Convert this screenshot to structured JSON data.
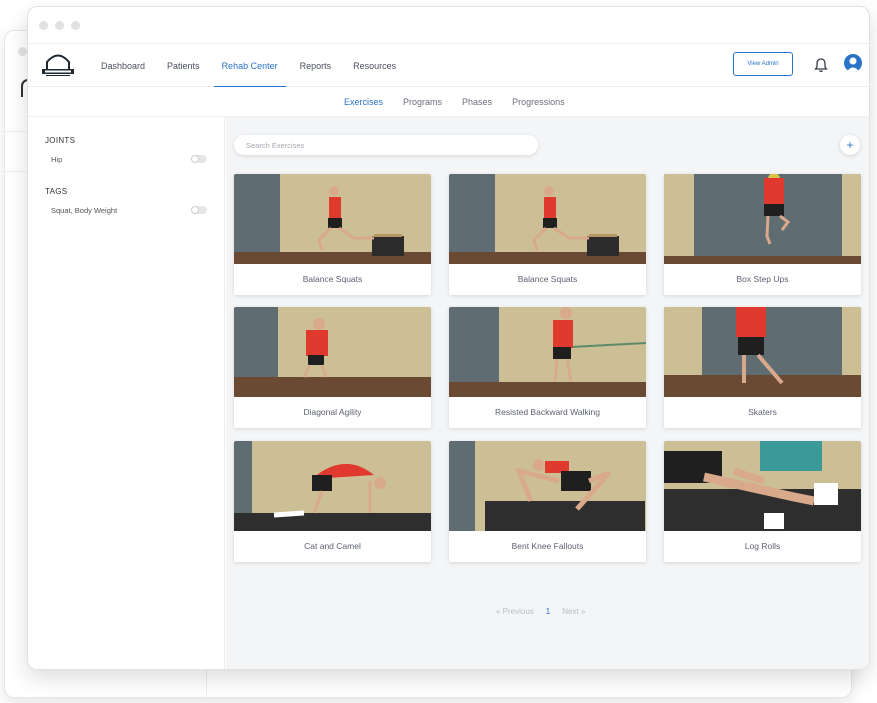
{
  "nav": {
    "links": [
      "Dashboard",
      "Patients",
      "Rehab Center",
      "Reports",
      "Resources"
    ],
    "active": "Rehab Center",
    "admin_button": "View Admin"
  },
  "subnav": {
    "tabs": [
      "Exercises",
      "Programs",
      "Phases",
      "Progressions"
    ],
    "active": "Exercises"
  },
  "filters": {
    "joints_heading": "JOINTS",
    "joints": [
      "Hip"
    ],
    "tags_heading": "TAGS",
    "tags": [
      "Squat, Body Weight"
    ]
  },
  "search": {
    "placeholder": "Search Exercises"
  },
  "add_label": "+",
  "exercises": [
    {
      "title": "Balance Squats"
    },
    {
      "title": "Balance Squats"
    },
    {
      "title": "Box Step Ups"
    },
    {
      "title": "Diagonal Agility"
    },
    {
      "title": "Resisted Backward Walking"
    },
    {
      "title": "Skaters"
    },
    {
      "title": "Cat and Camel"
    },
    {
      "title": "Bent Knee Fallouts"
    },
    {
      "title": "Log Rolls"
    }
  ],
  "pagination": {
    "previous": "« Previous",
    "current": "1",
    "next": "Next »"
  },
  "colors": {
    "accent": "#2a73c9",
    "wall": "#cfc39a",
    "wall_dark": "#5f6d73",
    "shirt": "#e03a2e",
    "floor": "#6a4a33"
  },
  "icons": {
    "bell": "bell-icon",
    "avatar": "user-avatar-icon",
    "logo": "head-logo-icon"
  }
}
